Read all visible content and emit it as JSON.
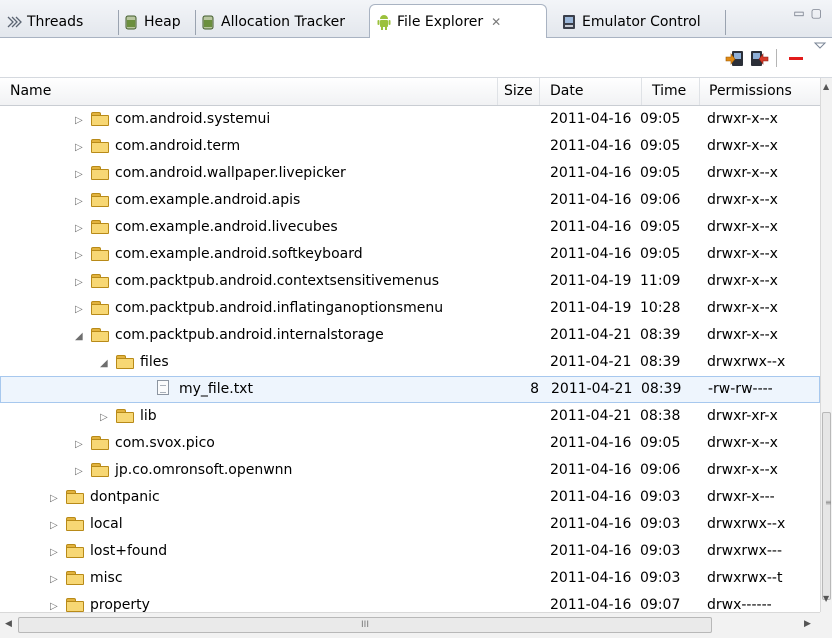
{
  "tabs": [
    {
      "label": "Threads",
      "icon": "threads-icon"
    },
    {
      "label": "Heap",
      "icon": "heap-icon"
    },
    {
      "label": "Allocation Tracker",
      "icon": "allocation-tracker-icon"
    },
    {
      "label": "File Explorer",
      "icon": "android-icon",
      "active": true,
      "close": "✕"
    },
    {
      "label": "Emulator Control",
      "icon": "emulator-control-icon"
    }
  ],
  "window_controls": {
    "minimize": "▭",
    "maximize": "▢"
  },
  "toolbar": {
    "pull_icon": "pull-file-icon",
    "push_icon": "push-file-icon",
    "delete_icon": "delete-icon",
    "menu_icon": "view-menu-icon"
  },
  "columns": {
    "name": "Name",
    "size": "Size",
    "date": "Date",
    "time": "Time",
    "permissions": "Permissions"
  },
  "rows": [
    {
      "level": 2,
      "expander": "▷",
      "type": "folder",
      "name": "com.android.systemui",
      "size": "",
      "date": "2011-04-16",
      "time": "09:05",
      "perm": "drwxr-x--x"
    },
    {
      "level": 2,
      "expander": "▷",
      "type": "folder",
      "name": "com.android.term",
      "size": "",
      "date": "2011-04-16",
      "time": "09:05",
      "perm": "drwxr-x--x"
    },
    {
      "level": 2,
      "expander": "▷",
      "type": "folder",
      "name": "com.android.wallpaper.livepicker",
      "size": "",
      "date": "2011-04-16",
      "time": "09:05",
      "perm": "drwxr-x--x"
    },
    {
      "level": 2,
      "expander": "▷",
      "type": "folder",
      "name": "com.example.android.apis",
      "size": "",
      "date": "2011-04-16",
      "time": "09:06",
      "perm": "drwxr-x--x"
    },
    {
      "level": 2,
      "expander": "▷",
      "type": "folder",
      "name": "com.example.android.livecubes",
      "size": "",
      "date": "2011-04-16",
      "time": "09:05",
      "perm": "drwxr-x--x"
    },
    {
      "level": 2,
      "expander": "▷",
      "type": "folder",
      "name": "com.example.android.softkeyboard",
      "size": "",
      "date": "2011-04-16",
      "time": "09:05",
      "perm": "drwxr-x--x"
    },
    {
      "level": 2,
      "expander": "▷",
      "type": "folder",
      "name": "com.packtpub.android.contextsensitivemenus",
      "size": "",
      "date": "2011-04-19",
      "time": "11:09",
      "perm": "drwxr-x--x"
    },
    {
      "level": 2,
      "expander": "▷",
      "type": "folder",
      "name": "com.packtpub.android.inflatinganoptionsmenu",
      "size": "",
      "date": "2011-04-19",
      "time": "10:28",
      "perm": "drwxr-x--x"
    },
    {
      "level": 2,
      "expander": "◢",
      "type": "folder",
      "name": "com.packtpub.android.internalstorage",
      "size": "",
      "date": "2011-04-21",
      "time": "08:39",
      "perm": "drwxr-x--x"
    },
    {
      "level": 3,
      "expander": "◢",
      "type": "folder",
      "name": "files",
      "size": "",
      "date": "2011-04-21",
      "time": "08:39",
      "perm": "drwxrwx--x"
    },
    {
      "level": 4,
      "expander": "",
      "type": "file",
      "name": "my_file.txt",
      "size": "8",
      "date": "2011-04-21",
      "time": "08:39",
      "perm": "-rw-rw----",
      "selected": true
    },
    {
      "level": 3,
      "expander": "▷",
      "type": "folder",
      "name": "lib",
      "size": "",
      "date": "2011-04-21",
      "time": "08:38",
      "perm": "drwxr-xr-x"
    },
    {
      "level": 2,
      "expander": "▷",
      "type": "folder",
      "name": "com.svox.pico",
      "size": "",
      "date": "2011-04-16",
      "time": "09:05",
      "perm": "drwxr-x--x"
    },
    {
      "level": 2,
      "expander": "▷",
      "type": "folder",
      "name": "jp.co.omronsoft.openwnn",
      "size": "",
      "date": "2011-04-16",
      "time": "09:06",
      "perm": "drwxr-x--x"
    },
    {
      "level": 1,
      "expander": "▷",
      "type": "folder",
      "name": "dontpanic",
      "size": "",
      "date": "2011-04-16",
      "time": "09:03",
      "perm": "drwxr-x---"
    },
    {
      "level": 1,
      "expander": "▷",
      "type": "folder",
      "name": "local",
      "size": "",
      "date": "2011-04-16",
      "time": "09:03",
      "perm": "drwxrwx--x"
    },
    {
      "level": 1,
      "expander": "▷",
      "type": "folder",
      "name": "lost+found",
      "size": "",
      "date": "2011-04-16",
      "time": "09:03",
      "perm": "drwxrwx---"
    },
    {
      "level": 1,
      "expander": "▷",
      "type": "folder",
      "name": "misc",
      "size": "",
      "date": "2011-04-16",
      "time": "09:03",
      "perm": "drwxrwx--t"
    },
    {
      "level": 1,
      "expander": "▷",
      "type": "folder",
      "name": "property",
      "size": "",
      "date": "2011-04-16",
      "time": "09:07",
      "perm": "drwx------"
    }
  ],
  "scrollbar": {
    "h_grip": "III",
    "v_grip": "≡",
    "up": "▲",
    "down": "▼",
    "left": "◀",
    "right": "▶"
  }
}
